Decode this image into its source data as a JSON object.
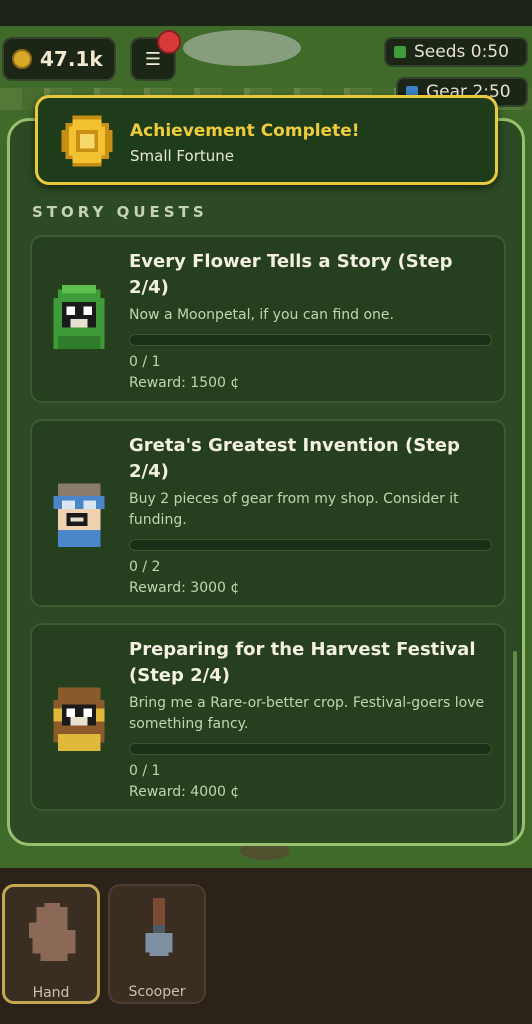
{
  "hud": {
    "coins": "47.1k",
    "menu_icon": "☰",
    "timers": [
      {
        "label": "Seeds 0:50",
        "color": "#3f9a3a"
      },
      {
        "label": "Gear 2:50",
        "color": "#3a7fc4"
      }
    ]
  },
  "toast": {
    "title": "Achievement Complete!",
    "subtitle": "Small Fortune",
    "icon": "coin-medal-icon"
  },
  "panel": {
    "section_title": "STORY QUESTS"
  },
  "quests": [
    {
      "title": "Every Flower Tells a Story (Step 2/4)",
      "description": "Now a Moonpetal, if you can find one.",
      "progress": "0 / 1",
      "progress_fraction": 0,
      "reward": "Reward: 1500 ¢",
      "avatar": "green-hooded-villager-icon"
    },
    {
      "title": "Greta's Greatest Invention (Step 2/4)",
      "description": "Buy 2 pieces of gear from my shop. Consider it funding.",
      "progress": "0 / 2",
      "progress_fraction": 0,
      "reward": "Reward: 3000 ¢",
      "avatar": "inventor-goggles-villager-icon"
    },
    {
      "title": "Preparing for the Harvest Festival (Step 2/4)",
      "description": "Bring me a Rare-or-better crop. Festival-goers love something fancy.",
      "progress": "0 / 1",
      "progress_fraction": 0,
      "reward": "Reward: 4000 ¢",
      "avatar": "bearded-farmer-villager-icon"
    }
  ],
  "tools": [
    {
      "label": "Hand",
      "icon": "hand-icon",
      "selected": true
    },
    {
      "label": "Scooper",
      "icon": "scooper-icon",
      "selected": false
    }
  ],
  "colors": {
    "accent": "#e9c93d",
    "panel_border": "#98c06e",
    "panel_bg": "#2c4a23"
  }
}
